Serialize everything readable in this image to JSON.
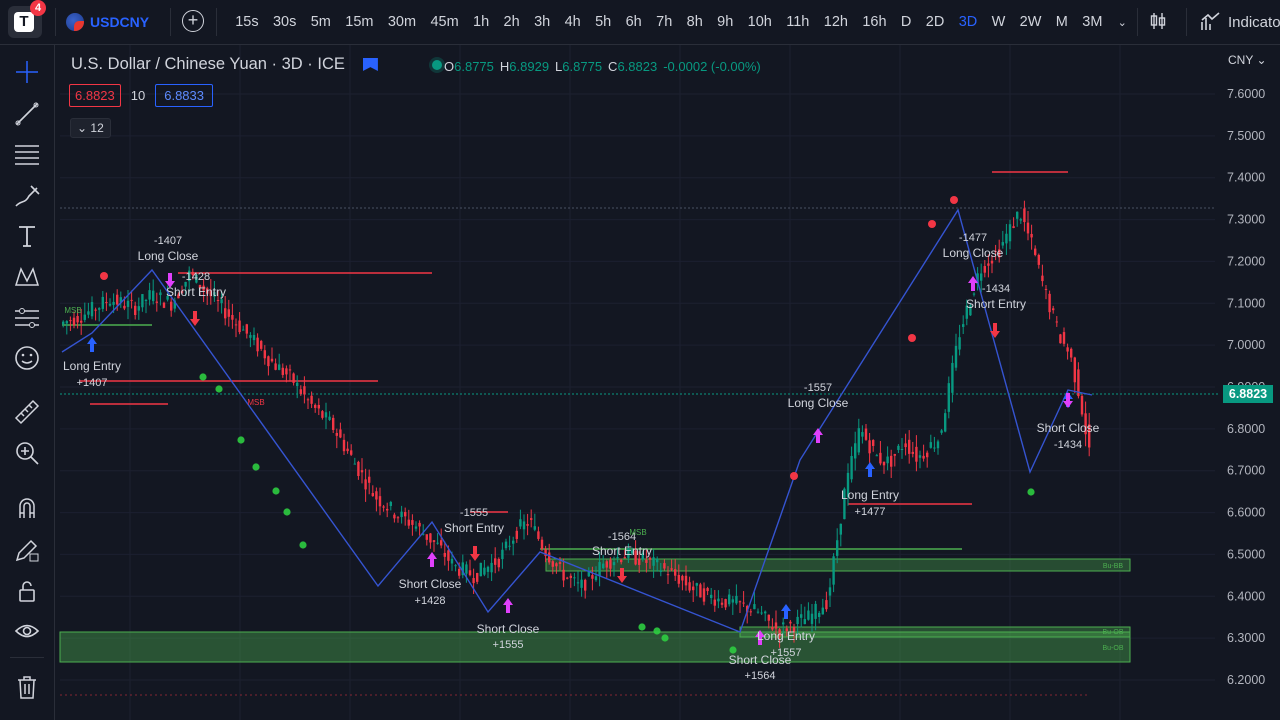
{
  "app": {
    "notification_count": "4",
    "logo_letter": "T"
  },
  "symbol": {
    "name": "USDCNY"
  },
  "intervals": [
    "15s",
    "30s",
    "5m",
    "15m",
    "30m",
    "45m",
    "1h",
    "2h",
    "3h",
    "4h",
    "5h",
    "6h",
    "7h",
    "8h",
    "9h",
    "10h",
    "11h",
    "12h",
    "16h",
    "D",
    "2D",
    "3D",
    "W",
    "2W",
    "M",
    "3M"
  ],
  "active_interval": "3D",
  "indicators_label": "Indicato",
  "legend": {
    "title": "U.S. Dollar / Chinese Yuan · 3D · ICE",
    "o_label": "O",
    "o": "6.8775",
    "h_label": "H",
    "h": "6.8929",
    "l_label": "L",
    "l": "6.8775",
    "c_label": "C",
    "c": "6.8823",
    "change": "-0.0002 (-0.00%)"
  },
  "quote": {
    "bid": "6.8823",
    "spread": "10",
    "ask": "6.8833"
  },
  "collapse_count": "12",
  "currency_label": "CNY",
  "price_axis": [
    "7.6000",
    "7.5000",
    "7.4000",
    "7.3000",
    "7.2000",
    "7.1000",
    "7.0000",
    "6.9000",
    "6.8000",
    "6.7000",
    "6.6000",
    "6.5000",
    "6.4000",
    "6.3000",
    "6.2000"
  ],
  "last_price": "6.8823",
  "colors": {
    "bull": "#089981",
    "bear": "#f23645",
    "accent": "#2962ff",
    "zigzag": "#3554d1",
    "signal": "#e040fb",
    "zone": "#4caf50"
  },
  "chart_data": {
    "type": "line",
    "series": [
      {
        "x": [
          0,
          30,
          50,
          75,
          92,
          112,
          130,
          150,
          170,
          190,
          212,
          232,
          250,
          272,
          292,
          315,
          335,
          355,
          378,
          395,
          415,
          440,
          458,
          470,
          483,
          500,
          520,
          545,
          565,
          580,
          600,
          615,
          632,
          650,
          662,
          680,
          700,
          708,
          718,
          730,
          750,
          768,
          785,
          800,
          818,
          830,
          845,
          858,
          880,
          900,
          920,
          940,
          960,
          972,
          985,
          1000,
          1010,
          1020,
          1030,
          1040,
          1050,
          1060
        ],
        "values": [
          7.05,
          7.08,
          7.11,
          7.09,
          7.12,
          7.1,
          7.17,
          7.12,
          7.07,
          7.02,
          6.96,
          6.92,
          6.86,
          6.81,
          6.73,
          6.64,
          6.6,
          6.57,
          6.52,
          6.47,
          6.45,
          6.49,
          6.56,
          6.58,
          6.52,
          6.46,
          6.42,
          6.48,
          6.5,
          6.49,
          6.47,
          6.45,
          6.42,
          6.4,
          6.39,
          6.38,
          6.36,
          6.34,
          6.32,
          6.33,
          6.35,
          6.39,
          6.65,
          6.8,
          6.73,
          6.72,
          6.77,
          6.73,
          6.78,
          7.03,
          7.18,
          7.23,
          7.32,
          7.24,
          7.13,
          7.02,
          6.98,
          6.88,
          6.74,
          6.78,
          6.85,
          6.88
        ]
      }
    ],
    "ylim": [
      6.2,
      7.62
    ]
  },
  "annotations": [
    {
      "text": "-1407"
    },
    {
      "text": "Long Close"
    },
    {
      "text": "-1428"
    },
    {
      "text": "Short Entry"
    },
    {
      "text": "Long Entry"
    },
    {
      "text": "+1407"
    },
    {
      "text": "MSB"
    },
    {
      "text": "MSB"
    },
    {
      "text": "-1555"
    },
    {
      "text": "Short Entry"
    },
    {
      "text": "Short Close"
    },
    {
      "text": "+1428"
    },
    {
      "text": "Short Close"
    },
    {
      "text": "+1555"
    },
    {
      "text": "-1564"
    },
    {
      "text": "Short Entry"
    },
    {
      "text": "MSB"
    },
    {
      "text": "Long Entry"
    },
    {
      "text": "+1557"
    },
    {
      "text": "Short Close"
    },
    {
      "text": "+1564"
    },
    {
      "text": "-1557"
    },
    {
      "text": "Long Close"
    },
    {
      "text": "Long Entry"
    },
    {
      "text": "+1477"
    },
    {
      "text": "-1477"
    },
    {
      "text": "Long Close"
    },
    {
      "text": "-1434"
    },
    {
      "text": "Short Entry"
    },
    {
      "text": "Short Close"
    },
    {
      "text": "-1434"
    },
    {
      "text": "Bu-BB"
    },
    {
      "text": "Bu-OB"
    },
    {
      "text": "Bu-OB"
    }
  ]
}
